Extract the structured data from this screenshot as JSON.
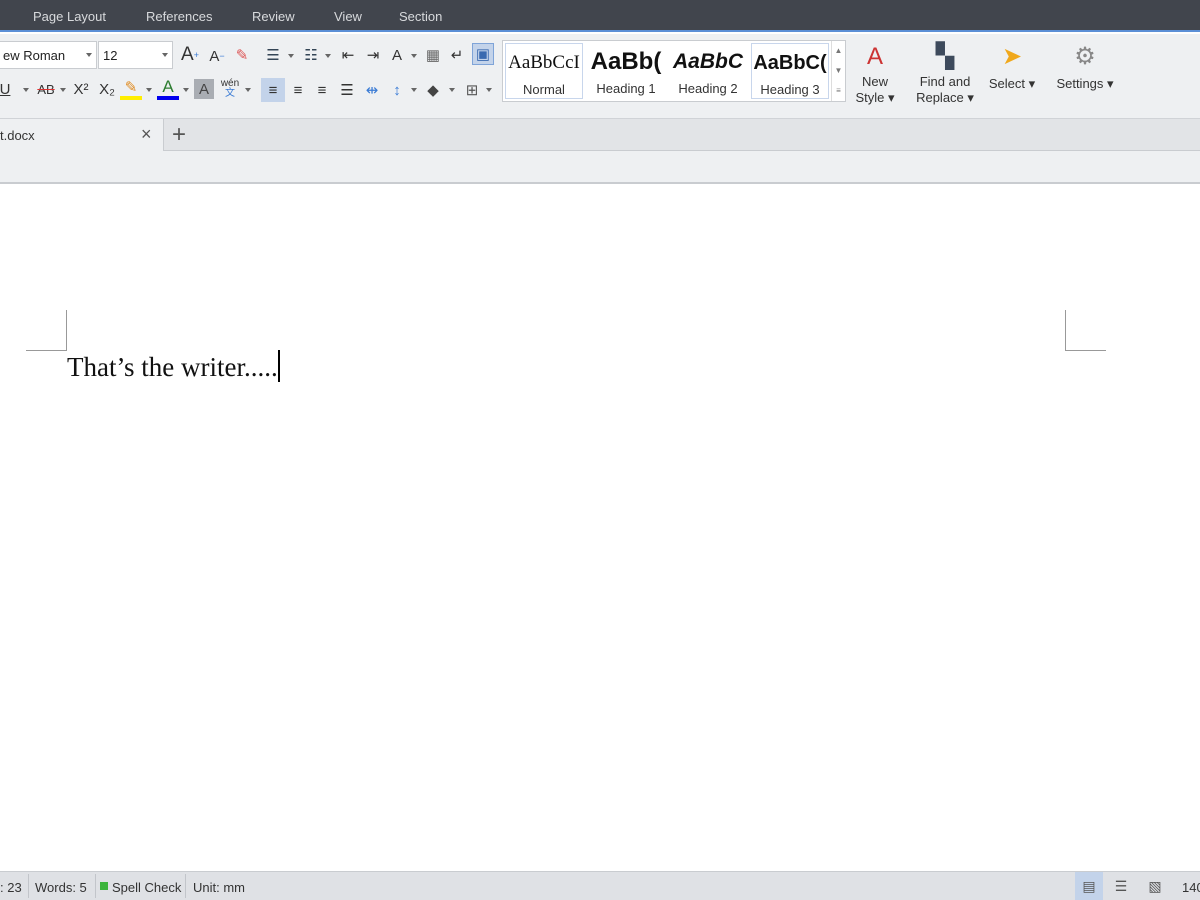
{
  "menu": {
    "items": [
      "Page Layout",
      "References",
      "Review",
      "View",
      "Section"
    ]
  },
  "toolbar": {
    "font_name": "ew Roman",
    "font_size": "12",
    "styles": [
      {
        "preview": "AaBbCcI",
        "name": "Normal"
      },
      {
        "preview": "AaBb(",
        "name": "Heading 1"
      },
      {
        "preview": "AaBbC",
        "name": "Heading 2"
      },
      {
        "preview": "AaBbC(",
        "name": "Heading 3"
      }
    ],
    "new_style": [
      "New",
      "Style"
    ],
    "find_replace": [
      "Find and",
      "Replace"
    ],
    "select": "Select",
    "settings": "Settings",
    "superscript": "X²",
    "subscript": "X₂",
    "underline": "U",
    "strike": "AB",
    "phonetic": "wén"
  },
  "tabs": {
    "doc_name": "t.docx",
    "close": "×",
    "add": "+"
  },
  "document": {
    "text": "That’s the writer....."
  },
  "status": {
    "chars": ": 23",
    "words": "Words: 5",
    "spell": "Spell Check",
    "unit": "Unit: mm",
    "zoom": "140"
  },
  "colors": {
    "accent": "#5b8fd6",
    "highlight": "#ffee00",
    "font_color": "#0000ee",
    "spell_ok": "#3cb43c"
  }
}
